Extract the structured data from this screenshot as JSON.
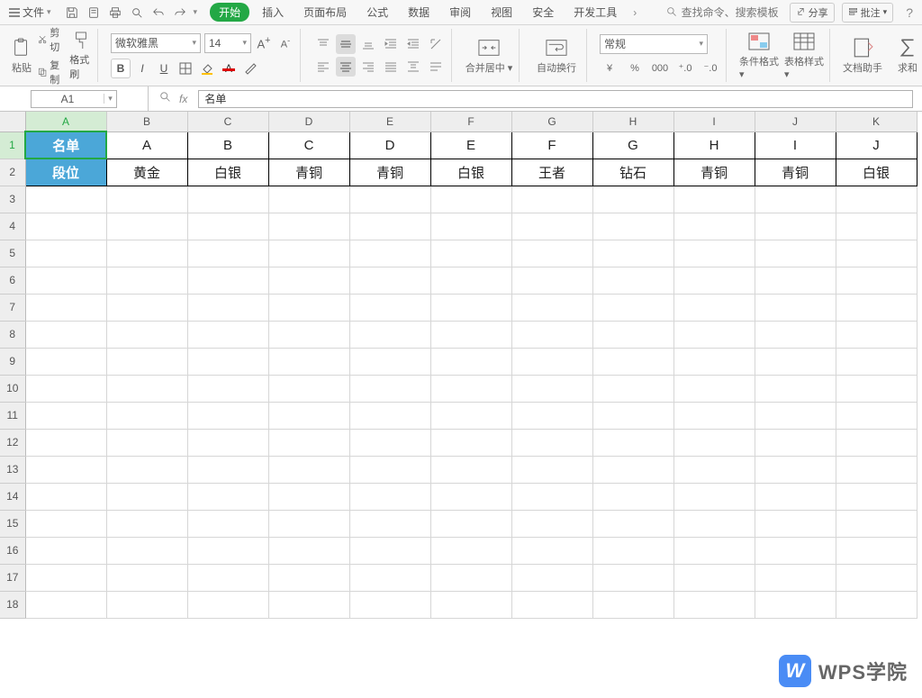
{
  "menu": {
    "file": "文件",
    "tabs": [
      "开始",
      "插入",
      "页面布局",
      "公式",
      "数据",
      "审阅",
      "视图",
      "安全",
      "开发工具"
    ],
    "overflow": "›",
    "search_placeholder": "查找命令、搜索模板",
    "share": "分享",
    "annotate": "批注",
    "help": "?"
  },
  "ribbon": {
    "paste": "粘贴",
    "cut": "剪切",
    "copy": "复制",
    "format_painter": "格式刷",
    "font_name": "微软雅黑",
    "font_size": "14",
    "merge_center": "合并居中",
    "wrap_text": "自动换行",
    "number_format": "常规",
    "cond_format": "条件格式",
    "table_style": "表格样式",
    "doc_assist": "文档助手",
    "sum": "求和",
    "currency_glyph": "¥",
    "percent_glyph": "%",
    "thousands_glyph": "000",
    "dec_inc_glyph": "⁺.0",
    "dec_dec_glyph": "⁻.0"
  },
  "formula_bar": {
    "cell_ref": "A1",
    "fx": "fx",
    "value": "名单"
  },
  "sheet": {
    "col_headers": [
      "A",
      "B",
      "C",
      "D",
      "E",
      "F",
      "G",
      "H",
      "I",
      "J",
      "K"
    ],
    "row_count": 18,
    "active_cell": {
      "row": 1,
      "col": 0
    },
    "data_rows": [
      {
        "header": "名单",
        "cells": [
          "A",
          "B",
          "C",
          "D",
          "E",
          "F",
          "G",
          "H",
          "I",
          "J"
        ]
      },
      {
        "header": "段位",
        "cells": [
          "黄金",
          "白银",
          "青铜",
          "青铜",
          "白银",
          "王者",
          "钻石",
          "青铜",
          "青铜",
          "白银"
        ]
      }
    ]
  },
  "watermark": {
    "logo": "W",
    "text": "WPS学院"
  }
}
